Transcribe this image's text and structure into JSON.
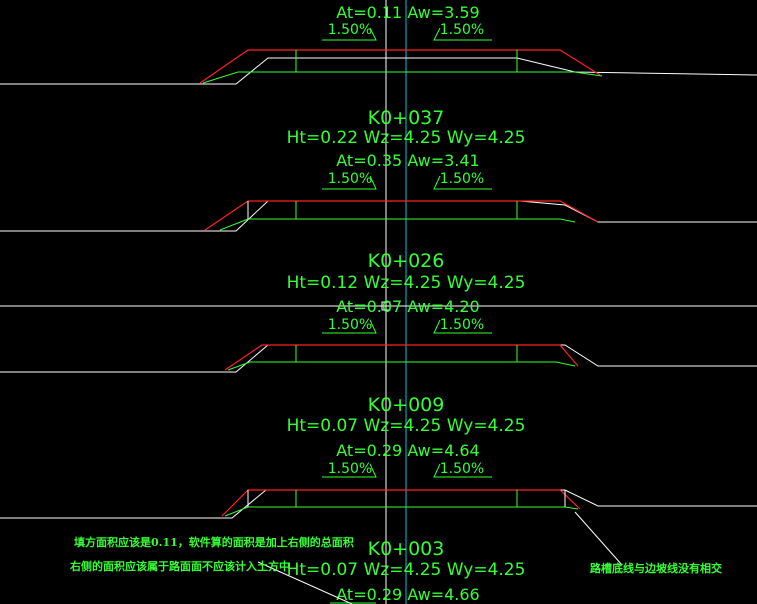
{
  "colors": {
    "background": "#000000",
    "ground_line": "#ffffff",
    "design_surface": "#ff2020",
    "subgrade": "#33ff33",
    "center_line_white": "#ffffff",
    "center_line_cyan": "#00c8d8",
    "text": "#33ff33"
  },
  "sections": [
    {
      "station": "",
      "params": "",
      "areas": "At=0.11 Aw=3.59",
      "slope_left": "1.50%",
      "slope_right": "1.50%"
    },
    {
      "station": "K0+037",
      "params": "Ht=0.22 Wz=4.25 Wy=4.25",
      "areas": "At=0.35 Aw=3.41",
      "slope_left": "1.50%",
      "slope_right": "1.50%"
    },
    {
      "station": "K0+026",
      "params": "Ht=0.12 Wz=4.25 Wy=4.25",
      "areas": "At=0.07 Aw=4.20",
      "slope_left": "1.50%",
      "slope_right": "1.50%"
    },
    {
      "station": "K0+009",
      "params": "Ht=0.07 Wz=4.25 Wy=4.25",
      "areas": "At=0.29 Aw=4.64",
      "slope_left": "1.50%",
      "slope_right": "1.50%"
    },
    {
      "station": "K0+003",
      "params": "Ht=0.07 Wz=4.25 Wy=4.25",
      "areas": "At=0.29 Aw=4.66",
      "slope_left": "",
      "slope_right": ""
    }
  ],
  "annotations": {
    "left_line1": "填方面积应该是0.11，软件算的面积是加上右侧的总面积",
    "left_line2": "右侧的面积应该属于路面面不应该计入土方中",
    "right": "路槽底线与边坡线没有相交"
  }
}
